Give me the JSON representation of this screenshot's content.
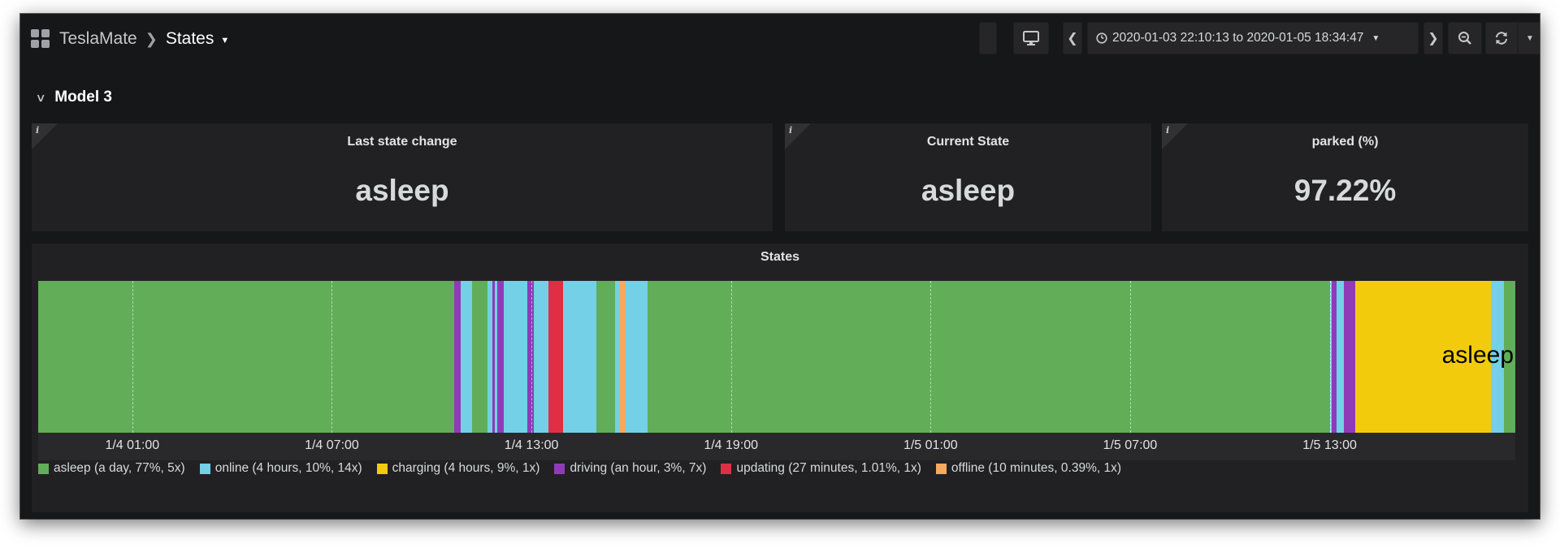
{
  "nav": {
    "breadcrumb_parent": "TeslaMate",
    "breadcrumb_current": "States",
    "time_range": "2020-01-03 22:10:13 to 2020-01-05 18:34:47"
  },
  "row": {
    "title": "Model 3"
  },
  "panels": [
    {
      "title": "Last state change",
      "value": "asleep"
    },
    {
      "title": "Current State",
      "value": "asleep"
    },
    {
      "title": "parked (%)",
      "value": "97.22%"
    }
  ],
  "states_panel": {
    "title": "States",
    "overlay_label": "asleep",
    "colors": {
      "asleep": "#61ad58",
      "online": "#73d0e6",
      "charging": "#f2cc0c",
      "driving": "#8f3bb8",
      "updating": "#e02f44",
      "offline": "#f5a95d"
    },
    "ticks": [
      "1/4 01:00",
      "1/4 07:00",
      "1/4 13:00",
      "1/4 19:00",
      "1/5 01:00",
      "1/5 07:00",
      "1/5 13:00"
    ],
    "legend": [
      {
        "state": "asleep",
        "label": "asleep (a day, 77%, 5x)"
      },
      {
        "state": "online",
        "label": "online (4 hours, 10%, 14x)"
      },
      {
        "state": "charging",
        "label": "charging (4 hours, 9%, 1x)"
      },
      {
        "state": "driving",
        "label": "driving (an hour, 3%, 7x)"
      },
      {
        "state": "updating",
        "label": "updating (27 minutes, 1.01%, 1x)"
      },
      {
        "state": "offline",
        "label": "offline (10 minutes, 0.39%, 1x)"
      }
    ],
    "segments": [
      {
        "state": "driving",
        "start": "2020-01-04 10:40",
        "end": "2020-01-04 10:53"
      },
      {
        "state": "online",
        "start": "2020-01-04 10:53",
        "end": "2020-01-04 11:13"
      },
      {
        "state": "online",
        "start": "2020-01-04 11:40",
        "end": "2020-01-04 11:49"
      },
      {
        "state": "driving",
        "start": "2020-01-04 11:49",
        "end": "2020-01-04 11:54"
      },
      {
        "state": "online",
        "start": "2020-01-04 11:54",
        "end": "2020-01-04 11:58"
      },
      {
        "state": "driving",
        "start": "2020-01-04 11:58",
        "end": "2020-01-04 12:10"
      },
      {
        "state": "online",
        "start": "2020-01-04 12:10",
        "end": "2020-01-04 12:52"
      },
      {
        "state": "driving",
        "start": "2020-01-04 12:52",
        "end": "2020-01-04 13:05"
      },
      {
        "state": "online",
        "start": "2020-01-04 13:05",
        "end": "2020-01-04 13:30"
      },
      {
        "state": "updating",
        "start": "2020-01-04 13:30",
        "end": "2020-01-04 13:57"
      },
      {
        "state": "online",
        "start": "2020-01-04 13:57",
        "end": "2020-01-04 14:57"
      },
      {
        "state": "online",
        "start": "2020-01-04 15:31",
        "end": "2020-01-04 15:40"
      },
      {
        "state": "offline",
        "start": "2020-01-04 15:40",
        "end": "2020-01-04 15:50"
      },
      {
        "state": "online",
        "start": "2020-01-04 15:50",
        "end": "2020-01-04 16:30"
      },
      {
        "state": "online",
        "start": "2020-01-05 13:00",
        "end": "2020-01-05 13:04"
      },
      {
        "state": "driving",
        "start": "2020-01-05 13:04",
        "end": "2020-01-05 13:12"
      },
      {
        "state": "online",
        "start": "2020-01-05 13:12",
        "end": "2020-01-05 13:25"
      },
      {
        "state": "driving",
        "start": "2020-01-05 13:25",
        "end": "2020-01-05 13:46"
      },
      {
        "state": "charging",
        "start": "2020-01-05 13:46",
        "end": "2020-01-05 17:51"
      },
      {
        "state": "online",
        "start": "2020-01-05 17:51",
        "end": "2020-01-05 18:14"
      }
    ]
  }
}
